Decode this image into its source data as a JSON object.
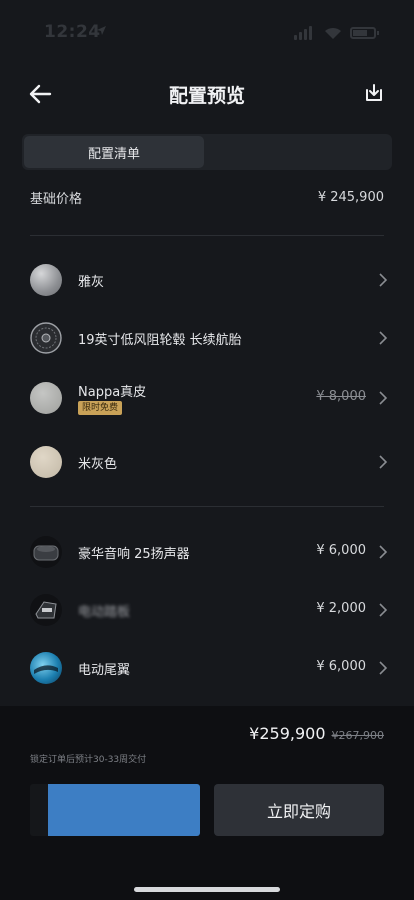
{
  "status_bar": {
    "time": "12:24",
    "location_icon": "location-arrow-icon"
  },
  "header": {
    "title": "配置预览",
    "back_icon": "back-arrow-icon",
    "download_icon": "download-icon"
  },
  "tabs": [
    {
      "label": "配置清单",
      "active": true
    }
  ],
  "base_price": {
    "label": "基础价格",
    "value": "¥ 245,900"
  },
  "options": [
    {
      "label": "雅灰",
      "price": "",
      "badge": "",
      "thumb": "gray-paint-swatch"
    },
    {
      "label": "19英寸低风阻轮毂 长续航胎",
      "price": "",
      "badge": "",
      "thumb": "wheel-icon"
    },
    {
      "label": "Nappa真皮",
      "price": "¥ 8,000",
      "price_struck": true,
      "badge": "限时免费",
      "thumb": "leather-swatch"
    },
    {
      "label": "米灰色",
      "price": "",
      "badge": "",
      "thumb": "beige-swatch"
    },
    {
      "label": "豪华音响 25扬声器",
      "price": "¥ 6,000",
      "badge": "",
      "thumb": "speaker-icon"
    },
    {
      "label": "电动踏板",
      "price": "¥ 2,000",
      "badge": "",
      "thumb": "step-icon",
      "blurred": true
    },
    {
      "label": "电动尾翼",
      "price": "¥ 6,000",
      "badge": "",
      "thumb": "spoiler-icon"
    }
  ],
  "summary": {
    "total": "¥259,900",
    "original": "¥267,900",
    "delivery_note": "锁定订单后预计30-33周交付"
  },
  "buttons": {
    "primary": "立即定购",
    "secondary": ""
  },
  "colors": {
    "background": "#16181c",
    "footer": "#0e0f12",
    "accent_blue": "#3d7ec4",
    "badge_gold": "#c9a258"
  }
}
